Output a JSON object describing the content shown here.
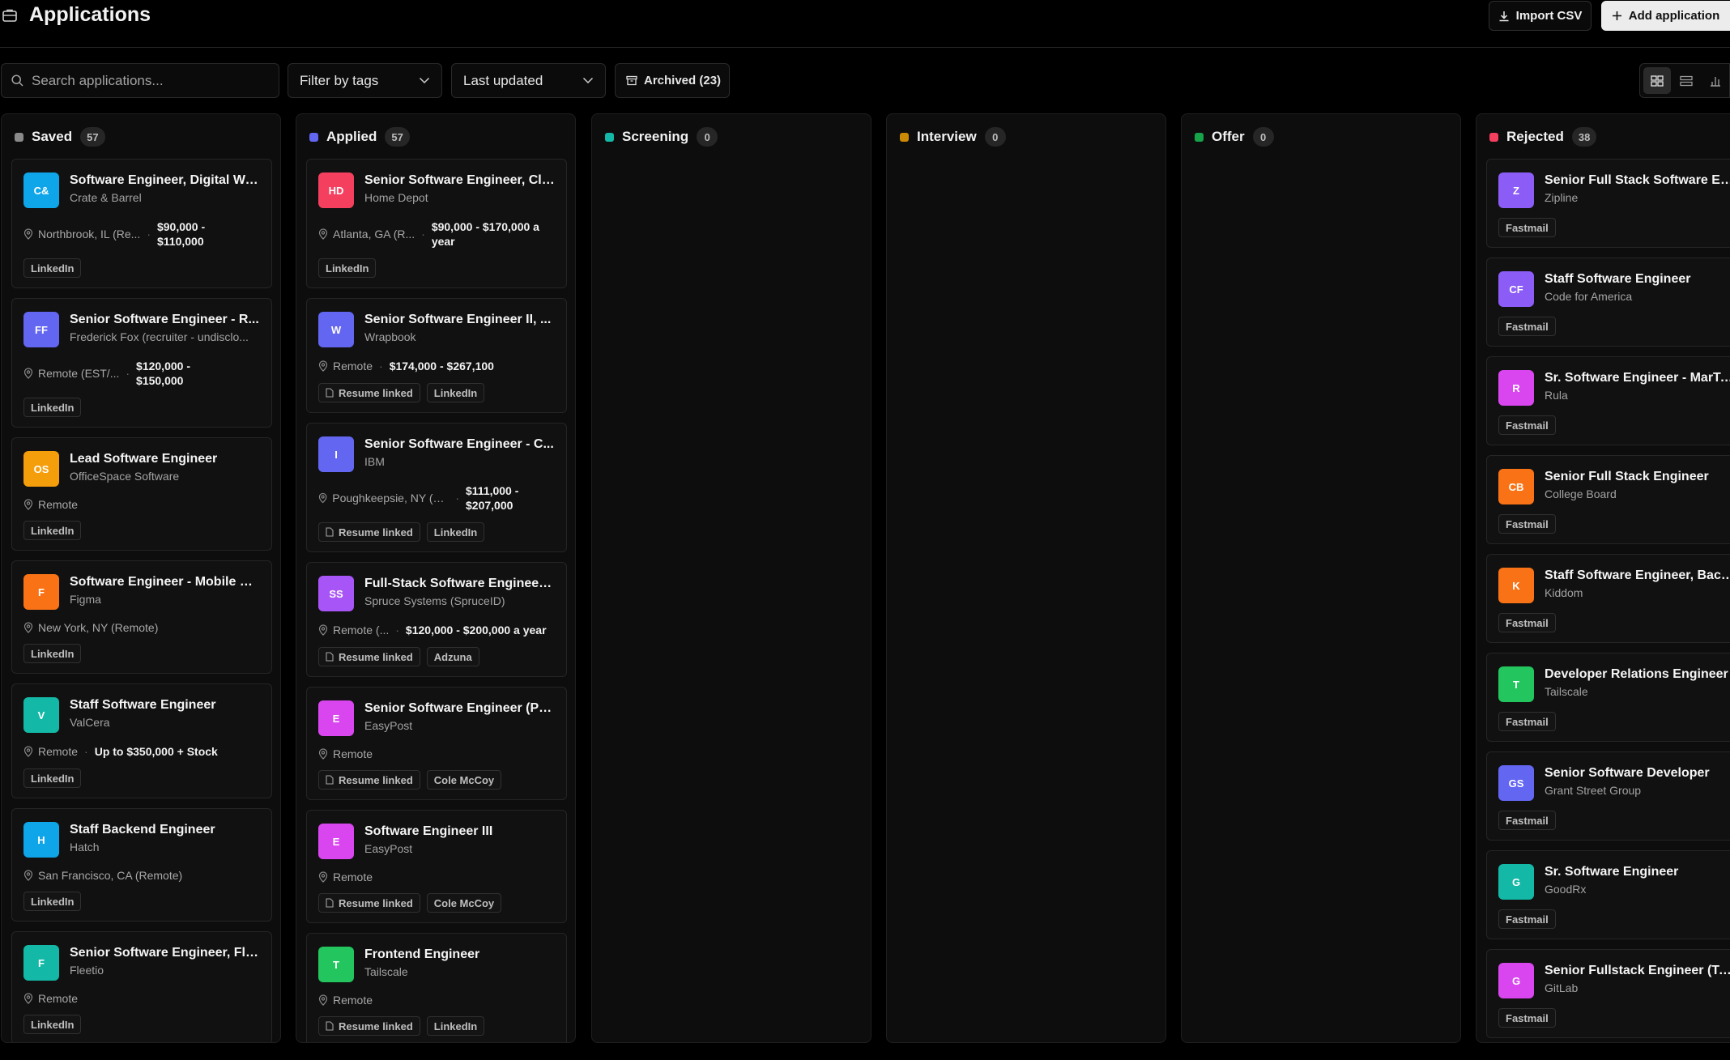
{
  "header": {
    "title": "Applications",
    "import_label": "Import CSV",
    "add_label": "Add application"
  },
  "toolbar": {
    "search_placeholder": "Search applications...",
    "filter_tags": "Filter by tags",
    "sort": "Last updated",
    "archived": "Archived (23)"
  },
  "colors": {
    "saved": "#8a8a8a",
    "applied": "#6366f1",
    "screening": "#14b8a6",
    "interview": "#ca8a04",
    "offer": "#16a34a",
    "rejected": "#f43f5e"
  },
  "columns": {
    "saved": {
      "name": "Saved",
      "count": "57",
      "cards": [
        {
          "initials": "C&",
          "color": "#0ea5e9",
          "title": "Software Engineer, Digital Wo...",
          "company": "Crate & Barrel",
          "location": "Northbrook, IL (Re...",
          "salary": "$90,000 - $110,000",
          "tags": [
            "LinkedIn"
          ]
        },
        {
          "initials": "FF",
          "color": "#6366f1",
          "title": "Senior Software Engineer - R...",
          "company": "Frederick Fox (recruiter - undisclo...",
          "location": "Remote (EST/...",
          "salary": "$120,000 - $150,000",
          "tags": [
            "LinkedIn"
          ]
        },
        {
          "initials": "OS",
          "color": "#f59e0b",
          "title": "Lead Software Engineer",
          "company": "OfficeSpace Software",
          "location": "Remote",
          "salary": "",
          "tags": [
            "LinkedIn"
          ]
        },
        {
          "initials": "F",
          "color": "#f97316",
          "title": "Software Engineer - Mobile W...",
          "company": "Figma",
          "location": "New York, NY (Remote)",
          "salary": "",
          "tags": [
            "LinkedIn"
          ]
        },
        {
          "initials": "V",
          "color": "#14b8a6",
          "title": "Staff Software Engineer",
          "company": "ValCera",
          "location": "Remote",
          "salary": "Up to $350,000 + Stock",
          "tags": [
            "LinkedIn"
          ]
        },
        {
          "initials": "H",
          "color": "#0ea5e9",
          "title": "Staff Backend Engineer",
          "company": "Hatch",
          "location": "San Francisco, CA (Remote)",
          "salary": "",
          "tags": [
            "LinkedIn"
          ]
        },
        {
          "initials": "F",
          "color": "#14b8a6",
          "title": "Senior Software Engineer, Fle...",
          "company": "Fleetio",
          "location": "Remote",
          "salary": "",
          "tags": [
            "LinkedIn"
          ]
        }
      ]
    },
    "applied": {
      "name": "Applied",
      "count": "57",
      "cards": [
        {
          "initials": "HD",
          "color": "#f43f5e",
          "title": "Senior Software Engineer, Clo...",
          "company": "Home Depot",
          "location": "Atlanta, GA (R...",
          "salary": "$90,000 - $170,000 a year",
          "tags": [
            "LinkedIn"
          ]
        },
        {
          "initials": "W",
          "color": "#6366f1",
          "title": "Senior Software Engineer II, ...",
          "company": "Wrapbook",
          "location": "Remote",
          "salary": "$174,000 - $267,100",
          "tags": [
            "Resume linked",
            "LinkedIn"
          ]
        },
        {
          "initials": "I",
          "color": "#6366f1",
          "title": "Senior Software Engineer - C...",
          "company": "IBM",
          "location": "Poughkeepsie, NY (Re...",
          "salary": "$111,000 - $207,000",
          "tags": [
            "Resume linked",
            "LinkedIn"
          ]
        },
        {
          "initials": "SS",
          "color": "#a855f7",
          "title": "Full-Stack Software Engineer ...",
          "company": "Spruce Systems (SpruceID)",
          "location": "Remote (...",
          "salary": "$120,000 - $200,000 a year",
          "tags": [
            "Resume linked",
            "Adzuna"
          ]
        },
        {
          "initials": "E",
          "color": "#d946ef",
          "title": "Senior Software Engineer (Py...",
          "company": "EasyPost",
          "location": "Remote",
          "salary": "",
          "tags": [
            "Resume linked",
            "Cole McCoy"
          ]
        },
        {
          "initials": "E",
          "color": "#d946ef",
          "title": "Software Engineer III",
          "company": "EasyPost",
          "location": "Remote",
          "salary": "",
          "tags": [
            "Resume linked",
            "Cole McCoy"
          ]
        },
        {
          "initials": "T",
          "color": "#22c55e",
          "title": "Frontend Engineer",
          "company": "Tailscale",
          "location": "Remote",
          "salary": "",
          "tags": [
            "Resume linked",
            "LinkedIn"
          ]
        }
      ]
    },
    "screening": {
      "name": "Screening",
      "count": "0",
      "cards": []
    },
    "interview": {
      "name": "Interview",
      "count": "0",
      "cards": []
    },
    "offer": {
      "name": "Offer",
      "count": "0",
      "cards": []
    },
    "rejected": {
      "name": "Rejected",
      "count": "38",
      "cards": [
        {
          "initials": "Z",
          "color": "#8b5cf6",
          "title": "Senior Full Stack Software En...",
          "company": "Zipline",
          "tags": [
            "Fastmail"
          ]
        },
        {
          "initials": "CF",
          "color": "#8b5cf6",
          "title": "Staff Software Engineer",
          "company": "Code for America",
          "tags": [
            "Fastmail"
          ]
        },
        {
          "initials": "R",
          "color": "#d946ef",
          "title": "Sr. Software Engineer - MarTe...",
          "company": "Rula",
          "tags": [
            "Fastmail"
          ]
        },
        {
          "initials": "CB",
          "color": "#f97316",
          "title": "Senior Full Stack Engineer",
          "company": "College Board",
          "tags": [
            "Fastmail"
          ]
        },
        {
          "initials": "K",
          "color": "#f97316",
          "title": "Staff Software Engineer, Back...",
          "company": "Kiddom",
          "tags": [
            "Fastmail"
          ]
        },
        {
          "initials": "T",
          "color": "#22c55e",
          "title": "Developer Relations Engineer",
          "company": "Tailscale",
          "tags": [
            "Fastmail"
          ]
        },
        {
          "initials": "GS",
          "color": "#6366f1",
          "title": "Senior Software Developer",
          "company": "Grant Street Group",
          "tags": [
            "Fastmail"
          ]
        },
        {
          "initials": "G",
          "color": "#14b8a6",
          "title": "Sr. Software Engineer",
          "company": "GoodRx",
          "tags": [
            "Fastmail"
          ]
        },
        {
          "initials": "G",
          "color": "#d946ef",
          "title": "Senior Fullstack Engineer (Ty...",
          "company": "GitLab",
          "tags": [
            "Fastmail"
          ]
        }
      ]
    }
  }
}
